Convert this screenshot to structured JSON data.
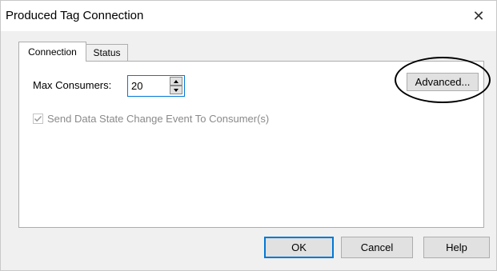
{
  "window": {
    "title": "Produced Tag Connection",
    "close_symbol": "✕"
  },
  "tabs": [
    {
      "label": "Connection",
      "active": true
    },
    {
      "label": "Status",
      "active": false
    }
  ],
  "connection_tab": {
    "max_consumers_label": "Max Consumers:",
    "max_consumers_value": "20",
    "send_event_label": "Send Data State Change Event To Consumer(s)",
    "send_event_checked": true,
    "send_event_enabled": false,
    "advanced_label": "Advanced..."
  },
  "footer": {
    "ok_label": "OK",
    "cancel_label": "Cancel",
    "help_label": "Help"
  },
  "colors": {
    "accent": "#0078d7",
    "disabled_text": "#8a8a8a",
    "dialog_bg": "#f0f0f0",
    "button_bg": "#e1e1e1"
  },
  "icons": {
    "close": "close-icon",
    "spin_up": "arrow-up-icon",
    "spin_down": "arrow-down-icon",
    "checkbox_mark": "check-icon"
  }
}
